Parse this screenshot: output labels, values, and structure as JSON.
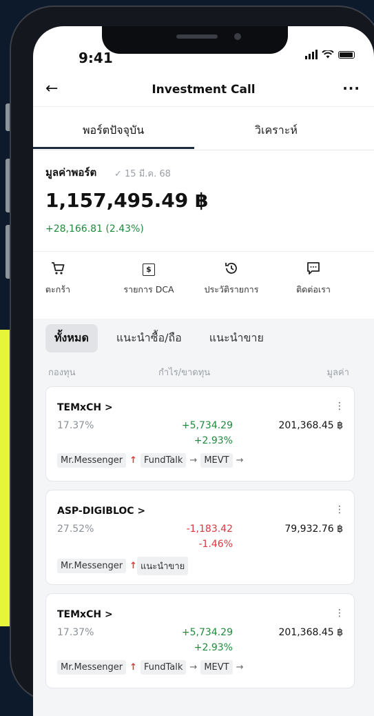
{
  "status": {
    "time": "9:41"
  },
  "header": {
    "title": "Investment Call",
    "back_icon": "←",
    "more_icon": "···"
  },
  "tabs": [
    {
      "label": "พอร์ตปัจจุบัน"
    },
    {
      "label": "วิเคราะห์"
    }
  ],
  "portfolio": {
    "label": "มูลค่าพอร์ต",
    "date": "✓ 15 มี.ค. 68",
    "value": "1,157,495.49 ฿",
    "change": "+28,166.81 (2.43%)"
  },
  "actions": [
    {
      "label": "ตะกร้า",
      "icon": "cart-icon"
    },
    {
      "label": "รายการ DCA",
      "icon": "dollar-box-icon"
    },
    {
      "label": "ประวัติรายการ",
      "icon": "history-icon"
    },
    {
      "label": "ติดต่อเรา",
      "icon": "chat-icon"
    }
  ],
  "filters": [
    "ทั้งหมด",
    "แนะนำซื้อ/ถือ",
    "แนะนำขาย"
  ],
  "columns": {
    "fund": "กองทุน",
    "profit": "กำไร/ขาดทุน",
    "value": "มูลค่า"
  },
  "funds": [
    {
      "name": "TEMxCH >",
      "weight": "17.37%",
      "gain": "+5,734.29",
      "gain_pct": "+2.93%",
      "value": "201,368.45 ฿",
      "tags": [
        "Mr.Messenger",
        "FundTalk",
        "MEVT"
      ]
    },
    {
      "name": "ASP-DIGIBLOC >",
      "weight": "27.52%",
      "gain": "-1,183.42",
      "gain_pct": "-1.46%",
      "value": "79,932.76 ฿",
      "tags": [
        "Mr.Messenger",
        "แนะนำขาย"
      ]
    },
    {
      "name": "TEMxCH >",
      "weight": "17.37%",
      "gain": "+5,734.29",
      "gain_pct": "+2.93%",
      "value": "201,368.45 ฿",
      "tags": [
        "Mr.Messenger",
        "FundTalk",
        "MEVT"
      ]
    }
  ],
  "colors": {
    "accent": "#e6f53a",
    "positive": "#1f8a3c",
    "negative": "#d9363e",
    "background": "#0d1a2c"
  }
}
